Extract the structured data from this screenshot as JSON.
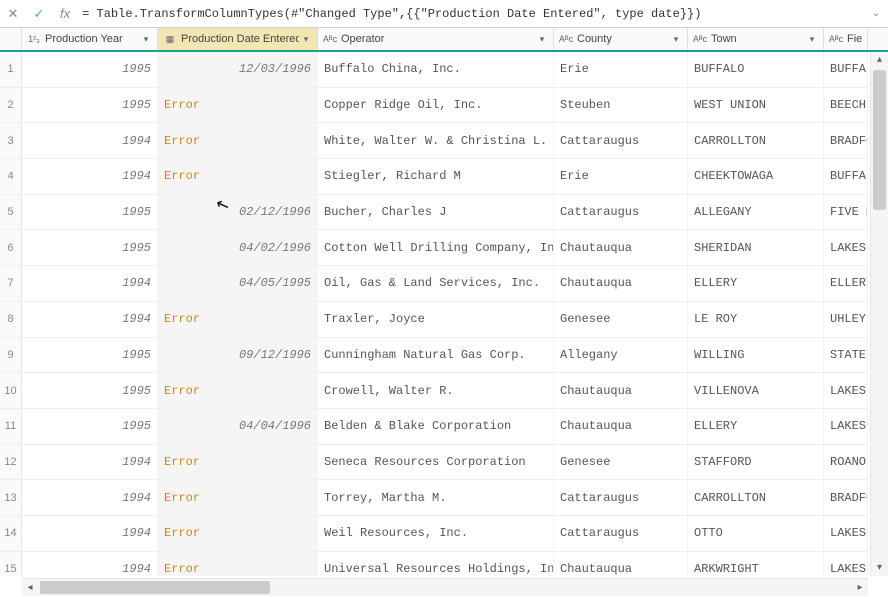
{
  "formula": "= Table.TransformColumnTypes(#\"Changed Type\",{{\"Production Date Entered\", type date}})",
  "columns": {
    "production_year": {
      "label": "Production Year",
      "type": "1²₃"
    },
    "production_date_entered": {
      "label": "Production Date Entered",
      "type": "📅"
    },
    "operator": {
      "label": "Operator",
      "type": "AᴮC"
    },
    "county": {
      "label": "County",
      "type": "AᴮC"
    },
    "town": {
      "label": "Town",
      "type": "AᴮC"
    },
    "field": {
      "label": "Field",
      "type": "AᴮC"
    }
  },
  "rows": [
    {
      "n": "1",
      "py": "1995",
      "pde": "12/03/1996",
      "op": "Buffalo China, Inc.",
      "county": "Erie",
      "town": "BUFFALO",
      "field": "BUFFALO"
    },
    {
      "n": "2",
      "py": "1995",
      "pde": "Error",
      "op": "Copper Ridge Oil, Inc.",
      "county": "Steuben",
      "town": "WEST UNION",
      "field": "BEECH H"
    },
    {
      "n": "3",
      "py": "1994",
      "pde": "Error",
      "op": "White, Walter W. & Christina L.",
      "county": "Cattaraugus",
      "town": "CARROLLTON",
      "field": "BRADFOR"
    },
    {
      "n": "4",
      "py": "1994",
      "pde": "Error",
      "op": "Stiegler, Richard M",
      "county": "Erie",
      "town": "CHEEKTOWAGA",
      "field": "BUFFALO"
    },
    {
      "n": "5",
      "py": "1995",
      "pde": "02/12/1996",
      "op": "Bucher, Charles J",
      "county": "Cattaraugus",
      "town": "ALLEGANY",
      "field": "FIVE MI"
    },
    {
      "n": "6",
      "py": "1995",
      "pde": "04/02/1996",
      "op": "Cotton Well Drilling Company,  Inc.",
      "county": "Chautauqua",
      "town": "SHERIDAN",
      "field": "LAKESHO"
    },
    {
      "n": "7",
      "py": "1994",
      "pde": "04/05/1995",
      "op": "Oil, Gas & Land Services, Inc.",
      "county": "Chautauqua",
      "town": "ELLERY",
      "field": "ELLERY"
    },
    {
      "n": "8",
      "py": "1994",
      "pde": "Error",
      "op": "Traxler, Joyce",
      "county": "Genesee",
      "town": "LE ROY",
      "field": "UHLEY O"
    },
    {
      "n": "9",
      "py": "1995",
      "pde": "09/12/1996",
      "op": "Cunningham Natural Gas Corp.",
      "county": "Allegany",
      "town": "WILLING",
      "field": "STATE L"
    },
    {
      "n": "10",
      "py": "1995",
      "pde": "Error",
      "op": "Crowell, Walter R.",
      "county": "Chautauqua",
      "town": "VILLENOVA",
      "field": "LAKESHO"
    },
    {
      "n": "11",
      "py": "1995",
      "pde": "04/04/1996",
      "op": "Belden & Blake Corporation",
      "county": "Chautauqua",
      "town": "ELLERY",
      "field": "LAKESHO"
    },
    {
      "n": "12",
      "py": "1994",
      "pde": "Error",
      "op": "Seneca Resources Corporation",
      "county": "Genesee",
      "town": "STAFFORD",
      "field": "ROANOKE"
    },
    {
      "n": "13",
      "py": "1994",
      "pde": "Error",
      "op": "Torrey, Martha M.",
      "county": "Cattaraugus",
      "town": "CARROLLTON",
      "field": "BRADFOR"
    },
    {
      "n": "14",
      "py": "1994",
      "pde": "Error",
      "op": "Weil Resources, Inc.",
      "county": "Cattaraugus",
      "town": "OTTO",
      "field": "LAKESHO"
    },
    {
      "n": "15",
      "py": "1994",
      "pde": "Error",
      "op": "Universal Resources Holdings, Incorp…",
      "county": "Chautauqua",
      "town": "ARKWRIGHT",
      "field": "LAKESHO"
    }
  ],
  "icons": {
    "cancel": "✕",
    "commit": "✓",
    "fx": "fx",
    "dropdown": "⌄",
    "filter": "▾",
    "calendar": "▦",
    "number": "1²₃",
    "text": "Aᴮc",
    "arrow_up": "▴",
    "arrow_down": "▾",
    "arrow_left": "◂",
    "arrow_right": "▸"
  }
}
